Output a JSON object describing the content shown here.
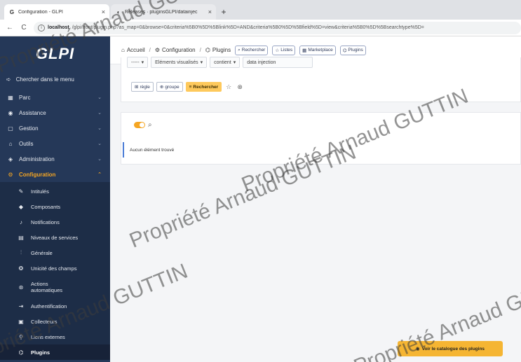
{
  "browser": {
    "tabs": [
      {
        "icon": "G",
        "title": "Configuration - GLPI",
        "close": "×"
      },
      {
        "icon": "◐",
        "title": "Releases · pluginsGLPI/datainjec",
        "close": "×"
      }
    ],
    "new_tab": "+",
    "back": "←",
    "reload": "C",
    "url_host": "localhost",
    "url_path": "/glpi/front/plugin.php?as_map=0&browse=0&criteria%5B0%5D%5Blink%5D=AND&criteria%5B0%5D%5Bfield%5D=view&criteria%5B0%5D%5Bsearchtype%5D="
  },
  "sidebar": {
    "logo": "GLPI",
    "search_label": "Chercher dans le menu",
    "items": [
      {
        "icon": "▦",
        "label": "Parc"
      },
      {
        "icon": "◉",
        "label": "Assistance"
      },
      {
        "icon": "▢",
        "label": "Gestion"
      },
      {
        "icon": "⌂",
        "label": "Outils"
      },
      {
        "icon": "◈",
        "label": "Administration"
      },
      {
        "icon": "⚙",
        "label": "Configuration"
      }
    ],
    "submenu": [
      {
        "icon": "✎",
        "label": "Intitulés"
      },
      {
        "icon": "◆",
        "label": "Composants"
      },
      {
        "icon": "♪",
        "label": "Notifications"
      },
      {
        "icon": "▤",
        "label": "Niveaux de services"
      },
      {
        "icon": "⫶",
        "label": "Générale"
      },
      {
        "icon": "❂",
        "label": "Unicité des champs"
      },
      {
        "icon": "⊛",
        "label": "Actions automatiques"
      },
      {
        "icon": "⇥",
        "label": "Authentification"
      },
      {
        "icon": "▣",
        "label": "Collecteurs"
      },
      {
        "icon": "⚲",
        "label": "Liens externes"
      },
      {
        "icon": "⌬",
        "label": "Plugins"
      }
    ]
  },
  "breadcrumb": {
    "home": "Accueil",
    "config": "Configuration",
    "plugins": "Plugins",
    "sep": "/"
  },
  "top_actions": {
    "search": "Rechercher",
    "lists": "Listes",
    "marketplace": "Marketplace",
    "plugins": "Plugins"
  },
  "criteria": {
    "field_a": "-----",
    "field_b": "Eléments visualisés",
    "operator": "contient",
    "value": "data injection"
  },
  "criteria_actions": {
    "rule": "règle",
    "group": "groupe",
    "search": "Rechercher",
    "star": "☆",
    "reset": "⊗"
  },
  "results": {
    "empty_message": "Aucun élément trouvé"
  },
  "catalogue_button": "Voir le catalogue des plugins",
  "watermark": "Propriété Arnaud GUTTIN"
}
